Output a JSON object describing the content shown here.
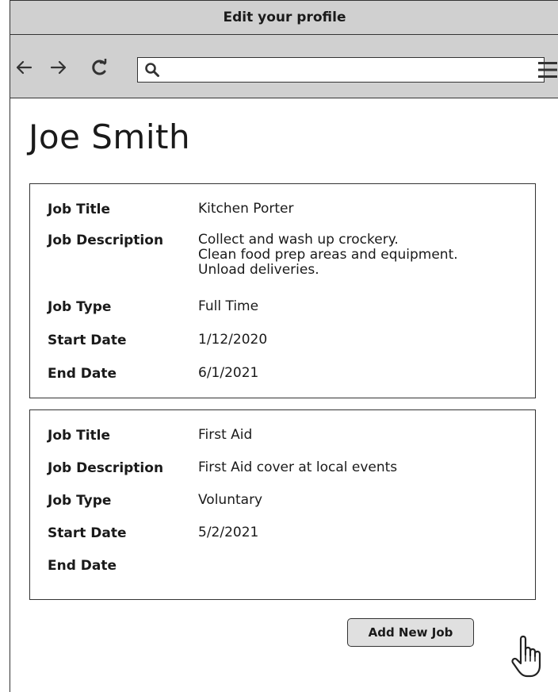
{
  "window": {
    "title": "Edit your profile"
  },
  "toolbar": {
    "back_icon": "arrow-left-icon",
    "forward_icon": "arrow-right-icon",
    "reload_icon": "reload-icon",
    "search_icon": "search-icon",
    "address_value": "",
    "menu_icon": "hamburger-menu-icon"
  },
  "profile": {
    "name": "Joe Smith"
  },
  "labels": {
    "job_title": "Job Title",
    "job_description": "Job Description",
    "job_type": "Job Type",
    "start_date": "Start Date",
    "end_date": "End Date"
  },
  "jobs": [
    {
      "title": "Kitchen Porter",
      "description": "Collect and wash up crockery.\nClean food prep areas and equipment.\nUnload deliveries.",
      "type": "Full Time",
      "start_date": "1/12/2020",
      "end_date": "6/1/2021"
    },
    {
      "title": "First Aid",
      "description": "First Aid cover at local events",
      "type": "Voluntary",
      "start_date": "5/2/2021",
      "end_date": ""
    }
  ],
  "actions": {
    "add_job_label": "Add New Job"
  },
  "colors": {
    "chrome": "#d0d0d0",
    "border": "#333333",
    "button_bg": "#e0e0e0"
  }
}
